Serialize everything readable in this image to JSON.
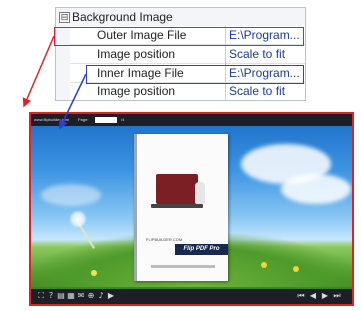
{
  "property_grid": {
    "category": {
      "expander": "⊟",
      "label": "Background Image"
    },
    "rows": [
      {
        "name": "Outer Image File",
        "value": "E:\\Program..."
      },
      {
        "name": "Image position",
        "value": "Scale to fit"
      },
      {
        "name": "Inner Image File",
        "value": "E:\\Program..."
      },
      {
        "name": "Image position",
        "value": "Scale to fit"
      }
    ]
  },
  "highlights": {
    "outer_color": "#e0212a",
    "inner_color": "#2b3fd6"
  },
  "preview": {
    "topbar": {
      "url": "www.flipbuilder.com",
      "page_label": "Page:",
      "page_value": "1",
      "page_total": "/4"
    },
    "book": {
      "brand": "FLIPBUILDER.COM",
      "band": "Flip PDF Pro"
    },
    "toolbar_left_icons": [
      "fullscreen-icon",
      "help-icon",
      "print-icon",
      "thumbnails-icon",
      "share-icon",
      "zoom-icon",
      "sound-icon",
      "autoflip-icon"
    ],
    "toolbar_right_icons": [
      "first-page-icon",
      "previous-page-icon",
      "next-page-icon",
      "last-page-icon"
    ]
  }
}
